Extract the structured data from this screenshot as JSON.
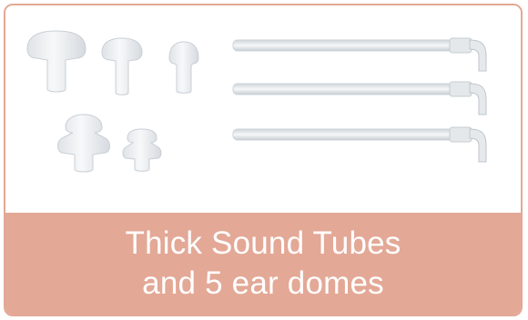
{
  "caption": {
    "line1": "Thick Sound Tubes",
    "line2": "and 5 ear domes"
  },
  "colors": {
    "accent": "#e3a896",
    "caption_text": "#ffffff",
    "product_tint": "#e8ebee"
  },
  "items": {
    "ear_domes_count": 5,
    "sound_tubes_count": 3
  }
}
